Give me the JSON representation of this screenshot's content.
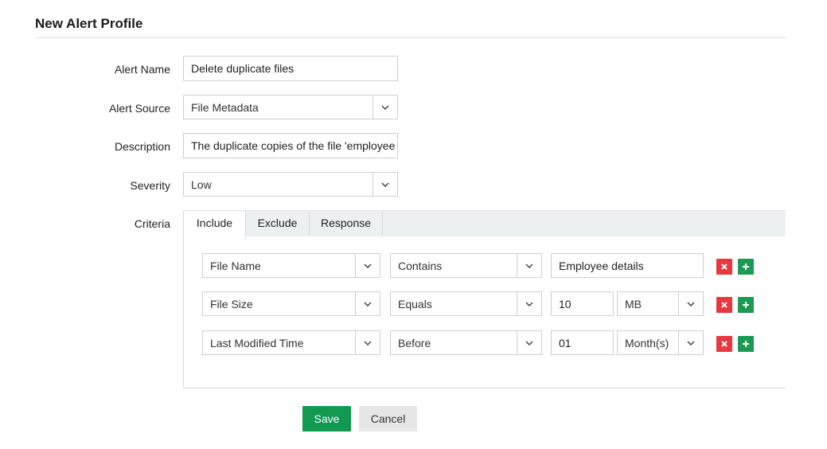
{
  "page": {
    "title": "New Alert Profile"
  },
  "form": {
    "alert_name": {
      "label": "Alert Name",
      "value": "Delete duplicate files"
    },
    "alert_source": {
      "label": "Alert Source",
      "value": "File Metadata"
    },
    "description": {
      "label": "Description",
      "value": "The duplicate copies of the file 'employee d"
    },
    "severity": {
      "label": "Severity",
      "value": "Low"
    },
    "criteria": {
      "label": "Criteria"
    }
  },
  "tabs": [
    {
      "label": "Include",
      "active": true
    },
    {
      "label": "Exclude",
      "active": false
    },
    {
      "label": "Response",
      "active": false
    }
  ],
  "criteria_rows": [
    {
      "field": "File Name",
      "operator": "Contains",
      "value": "Employee details",
      "unit": ""
    },
    {
      "field": "File Size",
      "operator": "Equals",
      "value": "10",
      "unit": "MB"
    },
    {
      "field": "Last Modified Time",
      "operator": "Before",
      "value": "01",
      "unit": "Month(s)"
    }
  ],
  "buttons": {
    "save": "Save",
    "cancel": "Cancel"
  },
  "colors": {
    "save": "#119950",
    "remove": "#e8383f",
    "add": "#1c9a53",
    "tabbar": "#ecf0f0"
  },
  "icons": {
    "caret": "chevron-down-icon",
    "remove": "close-icon",
    "add": "plus-icon"
  }
}
